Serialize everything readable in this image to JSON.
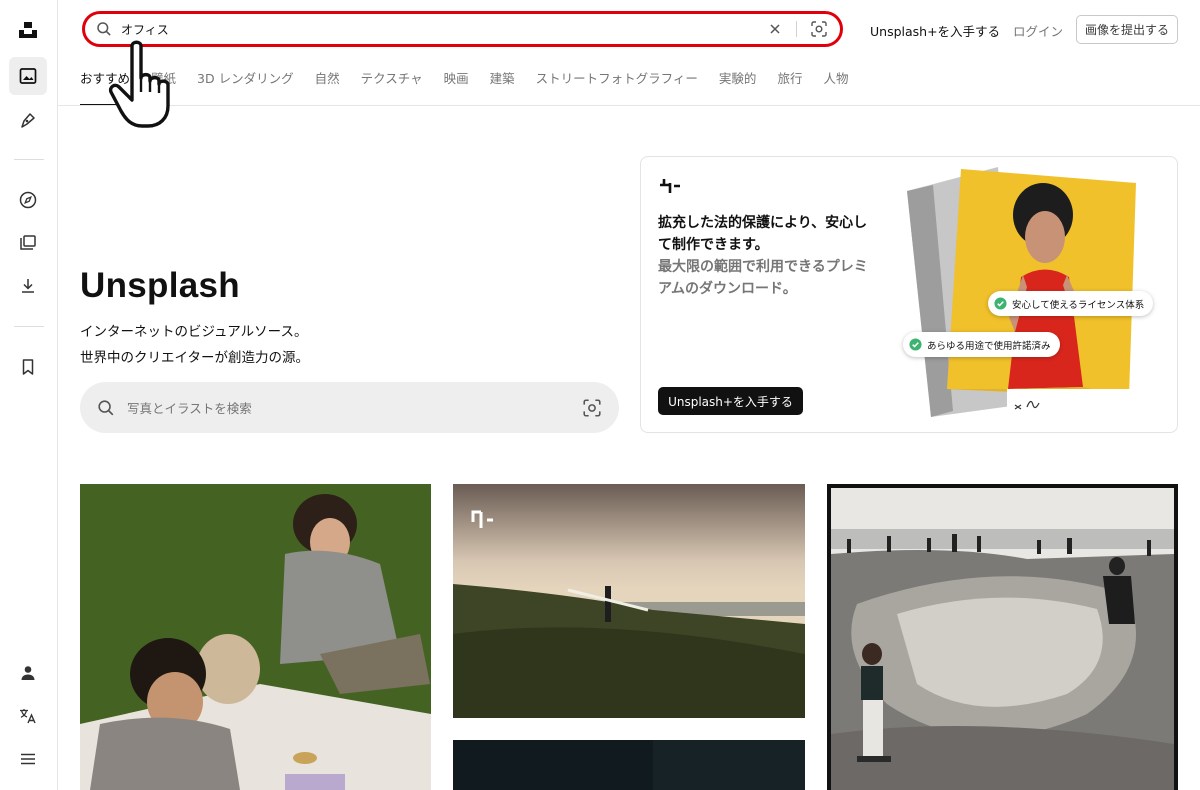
{
  "header": {
    "search_value": "オフィス",
    "plus_link": "Unsplash+を入手する",
    "login": "ログイン",
    "submit_button": "画像を提出する"
  },
  "tabs": [
    {
      "label": "おすすめ",
      "active": true
    },
    {
      "label": "壁紙",
      "active": false
    },
    {
      "label": "3D レンダリング",
      "active": false
    },
    {
      "label": "自然",
      "active": false
    },
    {
      "label": "テクスチャ",
      "active": false
    },
    {
      "label": "映画",
      "active": false
    },
    {
      "label": "建築",
      "active": false
    },
    {
      "label": "ストリートフォトグラフィー",
      "active": false
    },
    {
      "label": "実験的",
      "active": false
    },
    {
      "label": "旅行",
      "active": false
    },
    {
      "label": "人物",
      "active": false
    }
  ],
  "hero": {
    "title": "Unsplash",
    "subtitle_line1": "インターネットのビジュアルソース。",
    "subtitle_line2": "世界中のクリエイターが創造力の源。",
    "search_placeholder": "写真とイラストを検索"
  },
  "promo": {
    "headline_dark": "拡充した法的保護により、安心して制作できます。",
    "headline_gray": "最大限の範囲で利用できるプレミアムのダウンロード。",
    "button": "Unsplash+を入手する",
    "badge1": "安心して使えるライセンス体系",
    "badge2": "あらゆる用途で使用許諾済み"
  },
  "colors": {
    "highlight_red": "#e0000b",
    "badge_green": "#3cb371"
  },
  "icons": {
    "sidebar": [
      "unsplash-logo-icon",
      "image-icon",
      "pen-icon",
      "compass-icon",
      "collections-icon",
      "download-icon",
      "bookmark-icon",
      "user-icon",
      "translate-icon",
      "menu-icon"
    ],
    "search": [
      "search-icon",
      "clear-icon",
      "visual-search-icon"
    ],
    "pointer": "hand-pointer-icon"
  }
}
